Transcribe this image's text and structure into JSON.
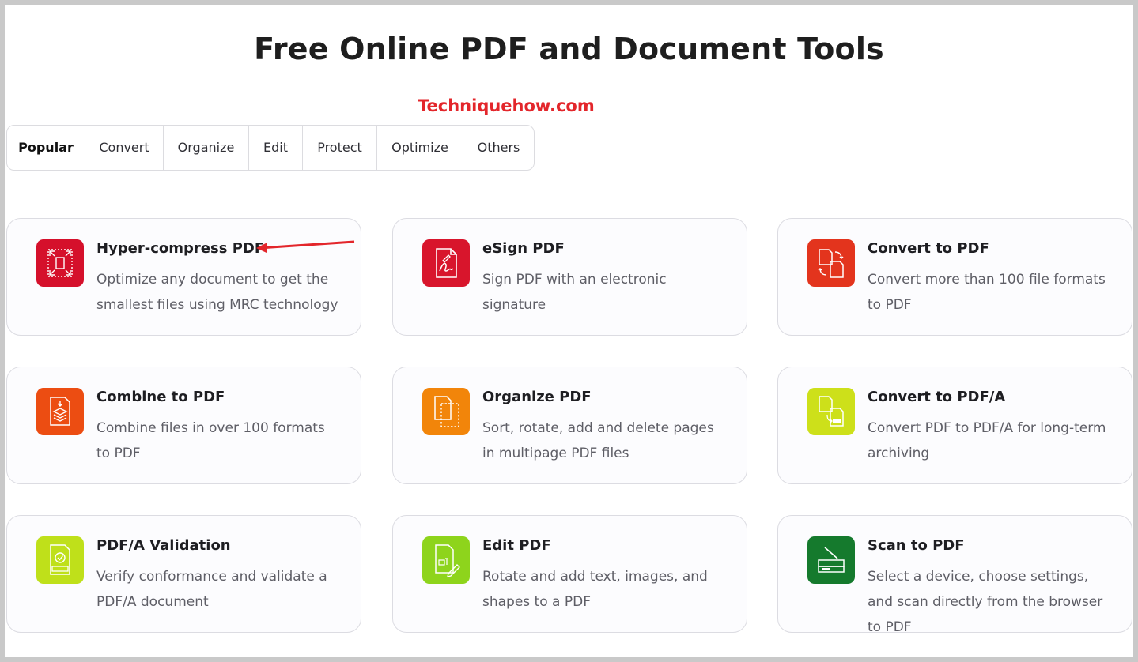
{
  "page": {
    "title": "Free Online PDF and Document Tools",
    "watermark": "Techniquehow.com"
  },
  "tabs": [
    {
      "label": "Popular",
      "active": true
    },
    {
      "label": "Convert",
      "active": false
    },
    {
      "label": "Organize",
      "active": false
    },
    {
      "label": "Edit",
      "active": false
    },
    {
      "label": "Protect",
      "active": false
    },
    {
      "label": "Optimize",
      "active": false
    },
    {
      "label": "Others",
      "active": false
    }
  ],
  "colors": {
    "watermark": "#e3262b",
    "arrow": "#e3262b"
  },
  "tools": [
    {
      "title": "Hyper-compress PDF",
      "desc": "Optimize any document to get the smallest files using MRC technology",
      "icon": "compress-icon",
      "color": "#d5102b"
    },
    {
      "title": "eSign PDF",
      "desc": "Sign PDF with an electronic signature",
      "icon": "signature-icon",
      "color": "#d8152c"
    },
    {
      "title": "Convert to PDF",
      "desc": "Convert more than 100 file formats to PDF",
      "icon": "convert-icon",
      "color": "#e3341d"
    },
    {
      "title": "Combine to PDF",
      "desc": "Combine files in over 100 formats to PDF",
      "icon": "combine-icon",
      "color": "#ec4d12"
    },
    {
      "title": "Organize PDF",
      "desc": "Sort, rotate, add and delete pages in multipage PDF files",
      "icon": "organize-icon",
      "color": "#f2850a"
    },
    {
      "title": "Convert to PDF/A",
      "desc": "Convert PDF to PDF/A for long-term archiving",
      "icon": "pdfa-convert-icon",
      "color": "#cde01a"
    },
    {
      "title": "PDF/A Validation",
      "desc": "Verify conformance and validate a PDF/A document",
      "icon": "pdfa-validate-icon",
      "color": "#bfe01a"
    },
    {
      "title": "Edit PDF",
      "desc": "Rotate and add text, images, and shapes to a PDF",
      "icon": "edit-icon",
      "color": "#8ed41c"
    },
    {
      "title": "Scan to PDF",
      "desc": "Select a device, choose settings, and scan directly from the browser to PDF",
      "icon": "scanner-icon",
      "color": "#157a2d"
    }
  ]
}
